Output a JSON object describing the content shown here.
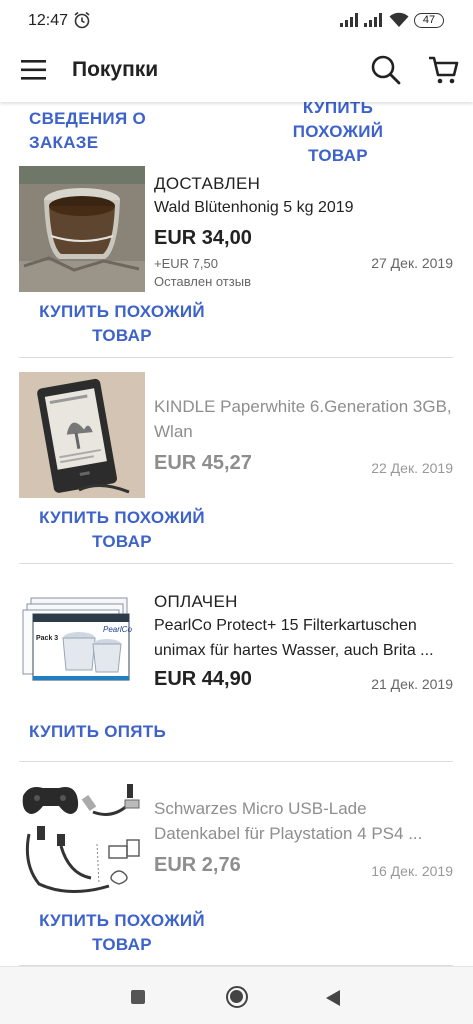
{
  "status_bar": {
    "time": "12:47",
    "battery": "47"
  },
  "app_bar": {
    "title": "Покупки"
  },
  "top_actions": {
    "order_details": "СВЕДЕНИЯ О ЗАКАЗЕ",
    "buy_similar": "КУПИТЬ ПОХОЖИЙ ТОВАР"
  },
  "orders": [
    {
      "status": "ДОСТАВЛЕН",
      "title": " Wald Blütenhonig 5 kg 2019",
      "price": "EUR 34,00",
      "shipping": "+EUR 7,50",
      "date": "27 Дек. 2019",
      "feedback": "Оставлен отзыв",
      "action": "КУПИТЬ ПОХОЖИЙ ТОВАР",
      "image_desc": "honey-jar-image"
    },
    {
      "status": "",
      "title": "KINDLE Paperwhite 6.Generation 3GB, Wlan",
      "price": "EUR 45,27",
      "date": "22 Дек. 2019",
      "action": "КУПИТЬ ПОХОЖИЙ ТОВАР",
      "image_desc": "kindle-image"
    },
    {
      "status": "ОПЛАЧЕН",
      "title": "PearlCo Protect+ 15 Filterkartuschen unimax für hartes Wasser, auch Brita ...",
      "price": "EUR 44,90",
      "date": "21 Дек. 2019",
      "action": "КУПИТЬ ОПЯТЬ",
      "image_desc": "filter-cartridges-image",
      "brand": "PearlCo",
      "pack": "Pack 3"
    },
    {
      "status": "",
      "title": "Schwarzes Micro USB-Lade Datenkabel für Playstation 4 PS4 ...",
      "price": "EUR 2,76",
      "date": "16 Дек. 2019",
      "action": "КУПИТЬ ПОХОЖИЙ ТОВАР",
      "image_desc": "usb-cable-image"
    }
  ],
  "colors": {
    "accent": "#3d62c9",
    "muted": "#8e8e8e"
  }
}
